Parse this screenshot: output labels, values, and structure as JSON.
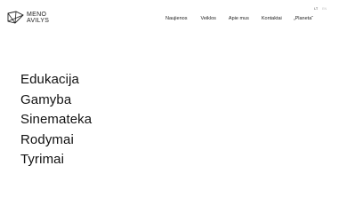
{
  "brand": {
    "line1": "MENO",
    "line2": "AVILYS",
    "logo_icon": "menu-avilys-logo-icon"
  },
  "languages": [
    "LT",
    "EN"
  ],
  "nav": [
    "Naujienos",
    "Veiklos",
    "Apie mus",
    "Kontaktai",
    "„Planeta“"
  ],
  "main_menu": [
    "Edukacija",
    "Gamyba",
    "Sinemateka",
    "Rodymai",
    "Tyrimai"
  ]
}
